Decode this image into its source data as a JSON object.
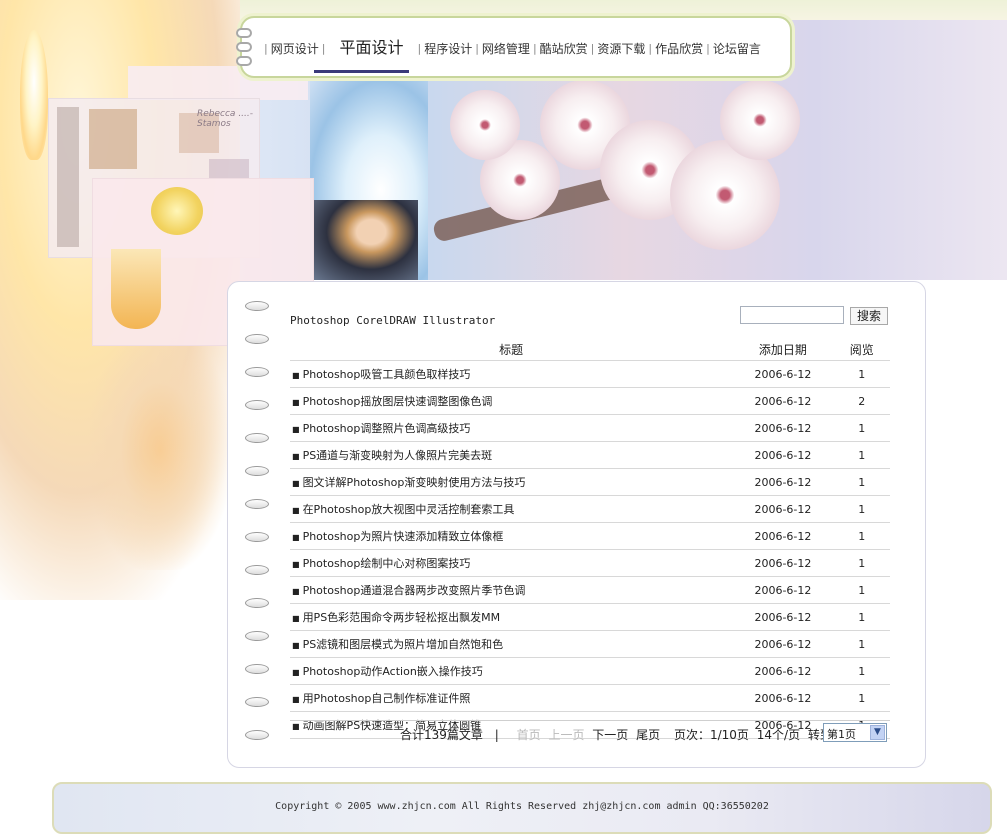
{
  "nav": {
    "items": [
      {
        "label": "网页设计",
        "active": false
      },
      {
        "label": "平面设计",
        "active": true
      },
      {
        "label": "程序设计",
        "active": false
      },
      {
        "label": "网络管理",
        "active": false
      },
      {
        "label": "酷站欣赏",
        "active": false
      },
      {
        "label": "资源下载",
        "active": false
      },
      {
        "label": "作品欣赏",
        "active": false
      },
      {
        "label": "论坛留言",
        "active": false
      }
    ]
  },
  "banner": {
    "caption": "Rebecca ....-Stamos"
  },
  "subnav": "Photoshop CorelDRAW Illustrator",
  "search": {
    "value": "",
    "button": "搜索"
  },
  "table": {
    "headers": [
      "标题",
      "添加日期",
      "阅览"
    ],
    "rows": [
      {
        "title": "Photoshop吸管工具颜色取样技巧",
        "date": "2006-6-12",
        "views": "1"
      },
      {
        "title": "Photoshop摇放图层快速调整图像色调",
        "date": "2006-6-12",
        "views": "2"
      },
      {
        "title": "Photoshop调整照片色调高级技巧",
        "date": "2006-6-12",
        "views": "1"
      },
      {
        "title": "PS通道与渐变映射为人像照片完美去斑",
        "date": "2006-6-12",
        "views": "1"
      },
      {
        "title": "图文详解Photoshop渐变映射使用方法与技巧",
        "date": "2006-6-12",
        "views": "1"
      },
      {
        "title": "在Photoshop放大视图中灵活控制套索工具",
        "date": "2006-6-12",
        "views": "1"
      },
      {
        "title": "Photoshop为照片快速添加精致立体像框",
        "date": "2006-6-12",
        "views": "1"
      },
      {
        "title": "Photoshop绘制中心对称图案技巧",
        "date": "2006-6-12",
        "views": "1"
      },
      {
        "title": "Photoshop通道混合器两步改变照片季节色调",
        "date": "2006-6-12",
        "views": "1"
      },
      {
        "title": "用PS色彩范围命令两步轻松抠出飘发MM",
        "date": "2006-6-12",
        "views": "1"
      },
      {
        "title": "PS滤镜和图层模式为照片增加自然饱和色",
        "date": "2006-6-12",
        "views": "1"
      },
      {
        "title": "Photoshop动作Action嵌入操作技巧",
        "date": "2006-6-12",
        "views": "1"
      },
      {
        "title": "用Photoshop自己制作标准证件照",
        "date": "2006-6-12",
        "views": "1"
      },
      {
        "title": "动画图解PS快速造型：简易立体圆锥",
        "date": "2006-6-12",
        "views": "1"
      }
    ]
  },
  "pager": {
    "total": "合计139篇文章",
    "separator": "|",
    "first": "首页",
    "prev": "上一页",
    "next": "下一页",
    "last": "尾页",
    "page_info": "页次：1/10页",
    "per_page": "14个/页",
    "goto": "转到:",
    "selected": "第1页"
  },
  "footer": {
    "copyright": "Copyright © 2005 www.zhjcn.com All Rights Reserved zhj@zhjcn.com admin QQ:36550202"
  }
}
